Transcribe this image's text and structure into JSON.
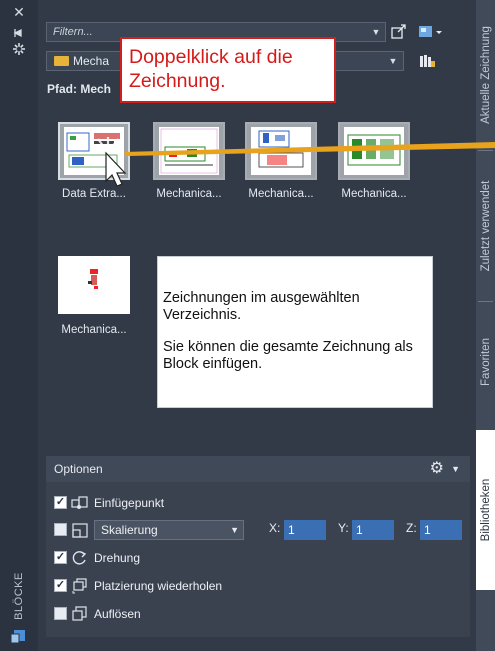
{
  "palette": {
    "title": "BLÖCKE",
    "filter_placeholder": "Filtern...",
    "folder_combo": "Mecha",
    "path_label": "Pfad: Mech",
    "thumbnails": [
      {
        "caption": "Data Extra..."
      },
      {
        "caption": "Mechanica..."
      },
      {
        "caption": "Mechanica..."
      },
      {
        "caption": "Mechanica..."
      },
      {
        "caption": "Mechanica..."
      }
    ],
    "tooltip": {
      "line1": "Zeichnungen im ausgewählten Verzeichnis.",
      "line2": "Sie können die gesamte Zeichnung als Block einfügen."
    }
  },
  "callout": {
    "text_line1": "Doppelklick auf die",
    "text_line2": "Zeichnung."
  },
  "options": {
    "header": "Optionen",
    "insertion_point": {
      "label": "Einfügepunkt",
      "checked": true
    },
    "scale": {
      "checked": false,
      "dropdown": "Skalierung",
      "x_label": "X:",
      "x": "1",
      "y_label": "Y:",
      "y": "1",
      "z_label": "Z:",
      "z": "1"
    },
    "rotation": {
      "label": "Drehung",
      "checked": true
    },
    "repeat": {
      "label": "Platzierung wiederholen",
      "checked": true
    },
    "explode": {
      "label": "Auflösen",
      "checked": false
    }
  },
  "tabs": [
    {
      "label": "Aktuelle Zeichnung",
      "active": false
    },
    {
      "label": "Zuletzt verwendet",
      "active": false
    },
    {
      "label": "Favoriten",
      "active": false
    },
    {
      "label": "Bibliotheken",
      "active": true
    }
  ],
  "colors": {
    "palette_bg": "#323a48",
    "callout_border": "#d01f1f",
    "callout_text": "#d51a1a",
    "arrow": "#e8a21c",
    "input_highlight": "#3b6fb4"
  },
  "icons": {
    "close": "close-icon",
    "pin": "autohide-icon",
    "settings": "properties-icon",
    "folder": "folder-icon",
    "gear": "gear-icon",
    "cursor": "mouse-pointer-icon"
  }
}
